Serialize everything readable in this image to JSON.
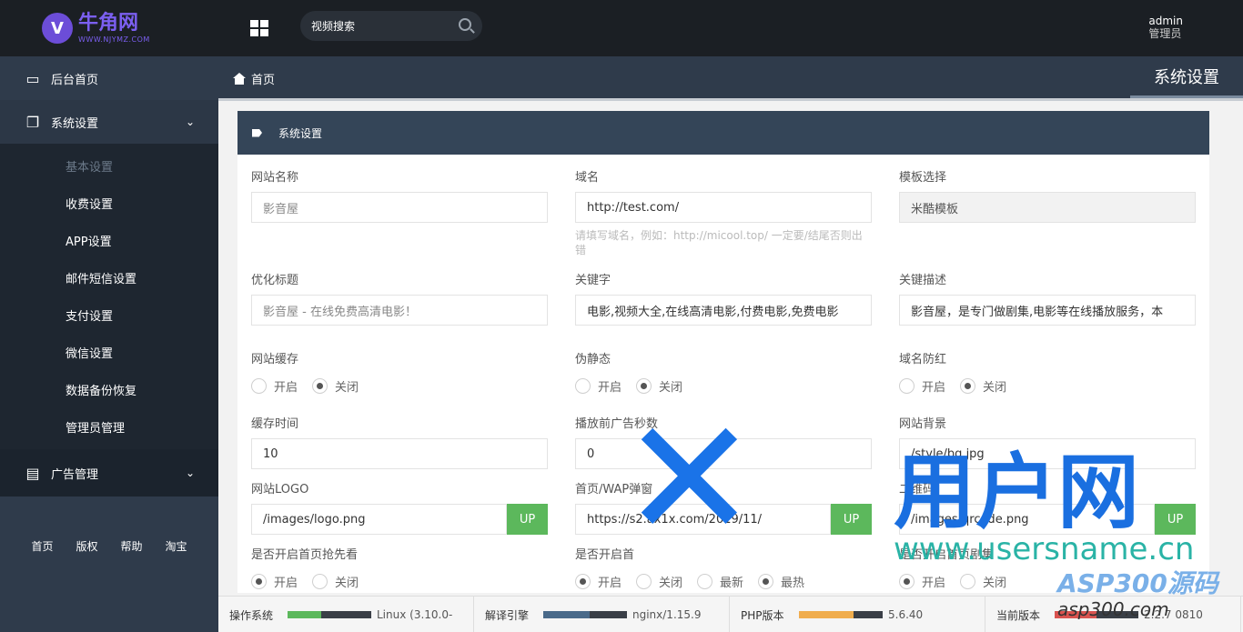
{
  "logo": {
    "title": "牛角网",
    "subtitle": "WWW.NJYMZ.COM"
  },
  "sidebar": {
    "home": "后台首页",
    "system": "系统设置",
    "sub_items": [
      "基本设置",
      "收费设置",
      "APP设置",
      "邮件短信设置",
      "支付设置",
      "微信设置",
      "数据备份恢复",
      "管理员管理"
    ],
    "ads": "广告管理",
    "footer_links": [
      "首页",
      "版权",
      "帮助",
      "淘宝"
    ]
  },
  "topbar": {
    "search_placeholder": "视频搜索",
    "user_name": "admin",
    "user_role": "管理员"
  },
  "breadcrumb": {
    "home": "首页",
    "page_title": "系统设置"
  },
  "panel": {
    "title": "系统设置",
    "site_name": {
      "label": "网站名称",
      "value": "影音屋"
    },
    "domain": {
      "label": "域名",
      "value": "http://test.com/",
      "hint": "请填写域名，例如：http://micool.top/ 一定要/结尾否则出错"
    },
    "template": {
      "label": "模板选择",
      "value": "米酷模板"
    },
    "seo_title": {
      "label": "优化标题",
      "value": "影音屋 - 在线免费高清电影！"
    },
    "keywords": {
      "label": "关键字",
      "value": "电影,视频大全,在线高清电影,付费电影,免费电影"
    },
    "description": {
      "label": "关键描述",
      "value": "影音屋，是专门做剧集,电影等在线播放服务，本"
    },
    "cache": {
      "label": "网站缓存",
      "options": [
        "开启",
        "关闭"
      ],
      "selected": 1
    },
    "rewrite": {
      "label": "伪静态",
      "options": [
        "开启",
        "关闭"
      ],
      "selected": 1
    },
    "domain_guard": {
      "label": "域名防红",
      "options": [
        "开启",
        "关闭"
      ],
      "selected": 1
    },
    "cache_time": {
      "label": "缓存时间",
      "value": "10"
    },
    "ad_seconds": {
      "label": "播放前广告秒数",
      "value": "0"
    },
    "bg": {
      "label": "网站背景",
      "value": "/style/bg.jpg"
    },
    "logo_field": {
      "label": "网站LOGO",
      "value": "/images/logo.png",
      "button": "UP"
    },
    "wap_popup": {
      "label": "首页/WAP弹窗",
      "value": "https://s2.ax1x.com/2019/11/",
      "button": "UP"
    },
    "qrcode": {
      "label": "二维码",
      "value": "/images/qrcode.png",
      "button": "UP"
    },
    "home_preview": {
      "label": "是否开启首页抢先看",
      "options": [
        "开启",
        "关闭"
      ],
      "selected": 0
    },
    "home_sort": {
      "label": "是否开启首",
      "options": [
        "开启",
        "关闭",
        "最新",
        "最热"
      ],
      "selected": [
        0,
        3
      ]
    },
    "series": {
      "label": "是否开启首页剧集",
      "options": [
        "开启",
        "关闭"
      ],
      "selected": 0
    }
  },
  "status": [
    {
      "label": "操作系统",
      "value": "Linux (3.10.0-",
      "color": "#5cb85c",
      "percent": 40
    },
    {
      "label": "解译引擎",
      "value": "nginx/1.15.9",
      "color": "#4a6a8a",
      "percent": 55
    },
    {
      "label": "PHP版本",
      "value": "5.6.40",
      "color": "#f0ad4e",
      "percent": 65
    },
    {
      "label": "当前版本",
      "value": "2.2.7 0810",
      "color": "#d9534f",
      "percent": 50
    }
  ],
  "watermark": {
    "brand": "用户网",
    "url": "www.usersname.cn",
    "asp": "ASP300源码",
    "asp_url": "asp300.com"
  }
}
